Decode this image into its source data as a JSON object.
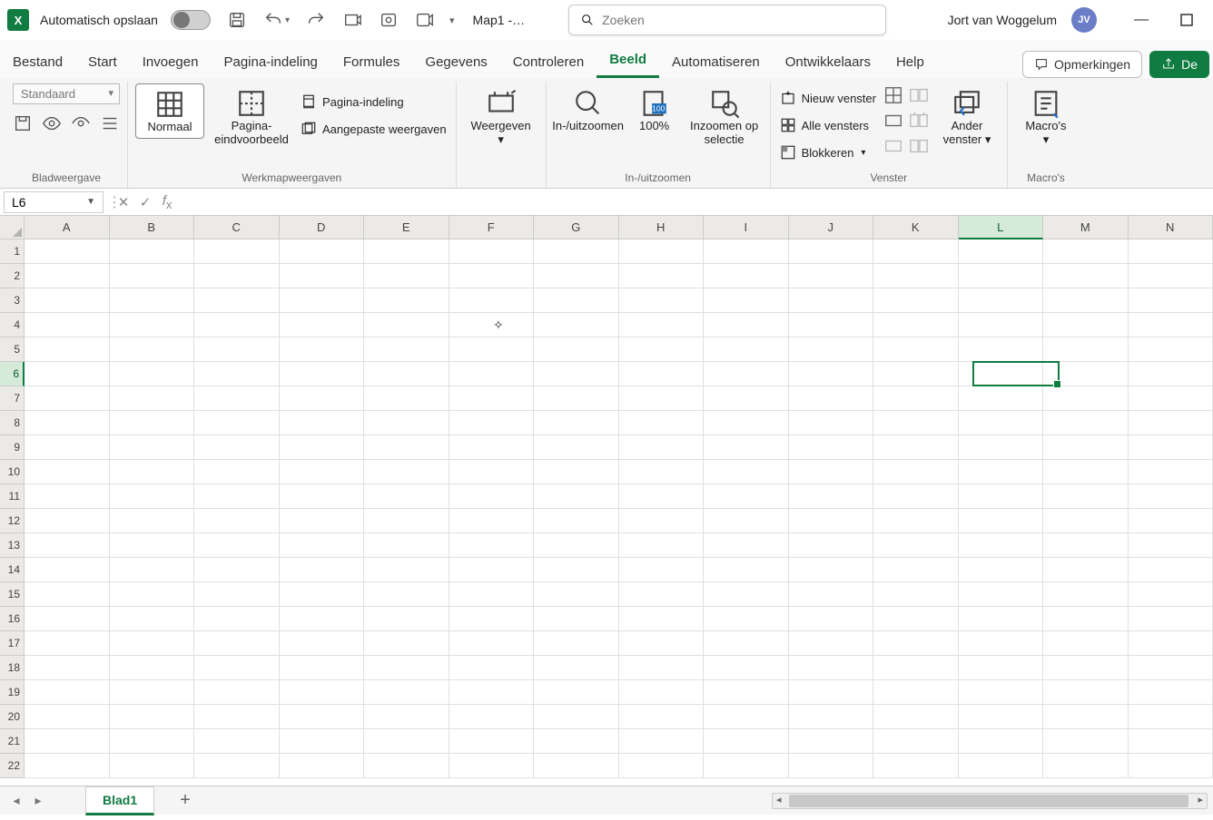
{
  "titlebar": {
    "autosave_label": "Automatisch opslaan",
    "doc_title": "Map1 -…",
    "search_placeholder": "Zoeken",
    "user_name": "Jort van Woggelum",
    "user_initials": "JV"
  },
  "tabs": {
    "items": [
      "Bestand",
      "Start",
      "Invoegen",
      "Pagina-indeling",
      "Formules",
      "Gegevens",
      "Controleren",
      "Beeld",
      "Automatiseren",
      "Ontwikkelaars",
      "Help"
    ],
    "active": "Beeld",
    "comments": "Opmerkingen",
    "share": "De"
  },
  "ribbon": {
    "bladweergave": {
      "dropdown": "Standaard",
      "group_label": "Bladweergave"
    },
    "werkmap": {
      "normaal": "Normaal",
      "pagina_einde": "Pagina-eindvoorbeeld",
      "pagina_indeling": "Pagina-indeling",
      "aangepast": "Aangepaste weergaven",
      "group_label": "Werkmapweergaven"
    },
    "weergeven": "Weergeven",
    "zoom": {
      "inuit": "In-/uitzoomen",
      "honderd": "100%",
      "selectie": "Inzoomen op selectie",
      "group_label": "In-/uitzoomen"
    },
    "venster": {
      "nieuw": "Nieuw venster",
      "alle": "Alle vensters",
      "blokkeren": "Blokkeren",
      "ander": "Ander venster",
      "group_label": "Venster"
    },
    "macros": {
      "label": "Macro's",
      "group_label": "Macro's"
    }
  },
  "formula": {
    "name_box": "L6",
    "value": ""
  },
  "grid": {
    "columns": [
      "A",
      "B",
      "C",
      "D",
      "E",
      "F",
      "G",
      "H",
      "I",
      "J",
      "K",
      "L",
      "M",
      "N"
    ],
    "rows": [
      "1",
      "2",
      "3",
      "4",
      "5",
      "6",
      "7",
      "8",
      "9",
      "10",
      "11",
      "12",
      "13",
      "14",
      "15",
      "16",
      "17",
      "18",
      "19",
      "20",
      "21",
      "22"
    ],
    "selected_col_index": 11,
    "selected_row_index": 5
  },
  "sheetbar": {
    "sheet": "Blad1"
  }
}
